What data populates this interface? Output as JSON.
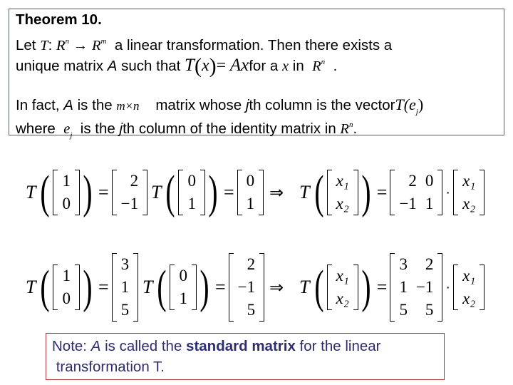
{
  "theorem": {
    "title": "Theorem 10.",
    "line1": {
      "let": "Let ",
      "T": "T",
      "colon": ":",
      "Rn": "R",
      "n": "n",
      "arrow": "→",
      "Rm": "R",
      "m": "m",
      "rest": "a linear transformation.  Then there exists a"
    },
    "line2": {
      "prefix": "unique matrix ",
      "A": "A",
      "mid": " such that ",
      "eq_T": "T",
      "eq_x": "x",
      "eq_equals": "=",
      "eq_Ax": "Ax",
      "for": "for a ",
      "x": "x",
      "in": " in ",
      "R": "R",
      "n": "n",
      "end": "."
    },
    "line3": {
      "prefix": "In fact, ",
      "A": "A",
      "mid": " is the ",
      "dims": "m×n",
      "rest1": " matrix whose ",
      "j": "j",
      "rest2": "th column is the vector",
      "Tej": "T(e",
      "j_sub": "j",
      "close": ")"
    },
    "line4": {
      "where": "where ",
      "e": "e",
      "j_sub": "j",
      "rest1": " is the ",
      "j": "j",
      "rest2": "th column of the identity matrix in ",
      "R": "R",
      "n": "n",
      "end": "."
    }
  },
  "example1": {
    "T": "T",
    "e1": [
      "1",
      "0"
    ],
    "Te1": [
      "2",
      "−1"
    ],
    "e2": [
      "0",
      "1"
    ],
    "Te2": [
      "0",
      "1"
    ],
    "implies": "⇒",
    "x": [
      "x₁",
      "x₂"
    ],
    "A": [
      [
        "2",
        "0"
      ],
      [
        "−1",
        "1"
      ]
    ],
    "equals": "=",
    "dot": "·"
  },
  "example2": {
    "T": "T",
    "e1": [
      "1",
      "0"
    ],
    "Te1": [
      "3",
      "1",
      "5"
    ],
    "e2": [
      "0",
      "1"
    ],
    "Te2": [
      "2",
      "−1",
      "5"
    ],
    "implies": "⇒",
    "x": [
      "x₁",
      "x₂"
    ],
    "A": [
      [
        "3",
        "2"
      ],
      [
        "1",
        "−1"
      ],
      [
        "5",
        "5"
      ]
    ],
    "equals": "=",
    "dot": "·"
  },
  "note": {
    "prefix": "Note: ",
    "A": "A",
    "mid": " is called the ",
    "bold": "standard matrix",
    "suffix": " for the linear",
    "line2": " transformation T."
  },
  "colors": {
    "border": "#555a66",
    "note_border": "#b0353d",
    "note_text": "#2c2c6e"
  }
}
